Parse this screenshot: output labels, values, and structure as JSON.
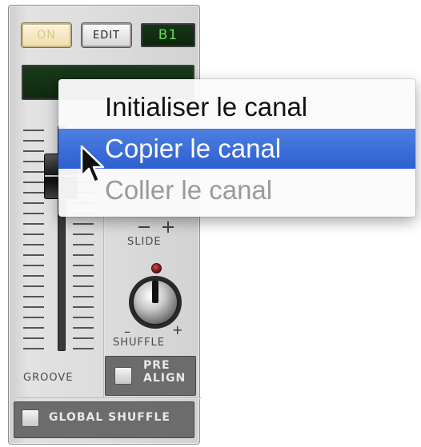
{
  "device": {
    "on_label": "ON",
    "edit_label": "EDIT",
    "pattern_display": "B1",
    "slide_label": "SLIDE",
    "shuffle_label": "SHUFFLE",
    "groove_label": "GROOVE",
    "pre_align_label_line1": "PRE",
    "pre_align_label_line2": "ALIGN",
    "global_shuffle_label": "GLOBAL SHUFFLE",
    "knob_minus": "–",
    "knob_plus": "+"
  },
  "context_menu": {
    "items": [
      {
        "label": "Initialiser le canal",
        "state": "normal"
      },
      {
        "label": "Copier le canal",
        "state": "highlighted"
      },
      {
        "label": "Coller le canal",
        "state": "disabled"
      }
    ]
  },
  "colors": {
    "menu_highlight": "#2d5fd0",
    "lcd_text": "#62dc52",
    "disabled_text": "#9a9a9a"
  },
  "icons": {
    "cursor": "arrow-cursor-icon"
  }
}
